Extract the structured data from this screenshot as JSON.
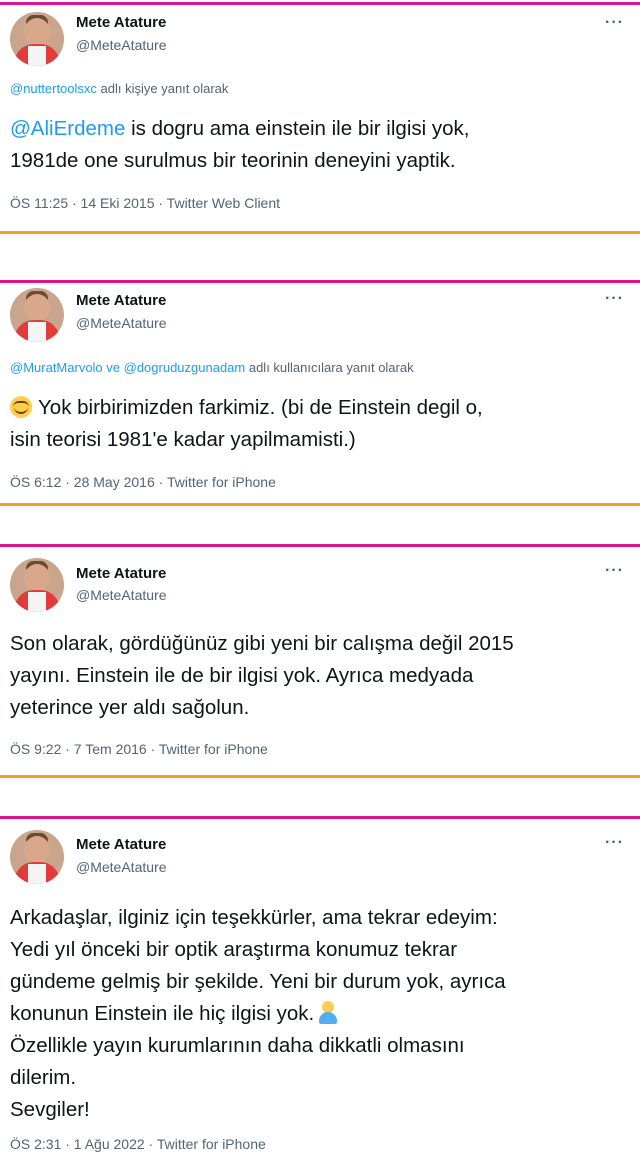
{
  "colors": {
    "top_border": "#e0148c",
    "bottom_border": "#f2a51a",
    "link": "#1d9bf0"
  },
  "tweets": [
    {
      "name": "Mete Atature",
      "handle": "@MeteAtature",
      "more": "···",
      "reply_mentions": "@nuttertoolsxc",
      "reply_suffix": " adlı kişiye yanıt olarak",
      "text_mention": "@AliErdeme",
      "text": " is dogru ama einstein ile bir ilgisi yok,\n1981de one surulmus bir teorinin deneyini yaptik.",
      "meta": "ÖS 11:25 · 14 Eki 2015 · Twitter Web Client"
    },
    {
      "name": "Mete Atature",
      "handle": "@MeteAtature",
      "more": "···",
      "reply_mentions": "@MuratMarvolo ve @dogruduzgunadam",
      "reply_suffix": " adlı kullanıcılara yanıt olarak",
      "emoji": "smiling-face-emoji",
      "text": "Yok birbirimizden farkimiz. (bi de Einstein degil o,\nisin teorisi 1981'e kadar yapilmamisti.)",
      "meta": "ÖS 6:12 · 28 May 2016 · Twitter for iPhone"
    },
    {
      "name": "Mete Atature",
      "handle": "@MeteAtature",
      "more": "···",
      "text": "Son olarak, gördüğünüz gibi yeni bir calışma değil 2015\nyayını. Einstein ile de bir ilgisi yok. Ayrıca medyada\nyeterince yer aldı sağolun.",
      "meta": "ÖS 9:22 · 7 Tem 2016 · Twitter for iPhone"
    },
    {
      "name": "Mete Atature",
      "handle": "@MeteAtature",
      "more": "···",
      "text_a": "Arkadaşlar, ilginiz için teşekkürler, ama tekrar edeyim:\nYedi yıl önceki bir optik araştırma konumuz tekrar\ngündeme gelmiş bir şekilde. Yeni bir durum yok, ayrıca\nkonunun Einstein ile hiç ilgisi yok.",
      "emoji": "facepalm-emoji",
      "text_b": "Özellikle yayın kurumlarının daha dikkatli olmasını\ndilerim.\nSevgiler!",
      "meta": "ÖS 2:31 · 1 Ağu 2022 · Twitter for iPhone"
    }
  ]
}
